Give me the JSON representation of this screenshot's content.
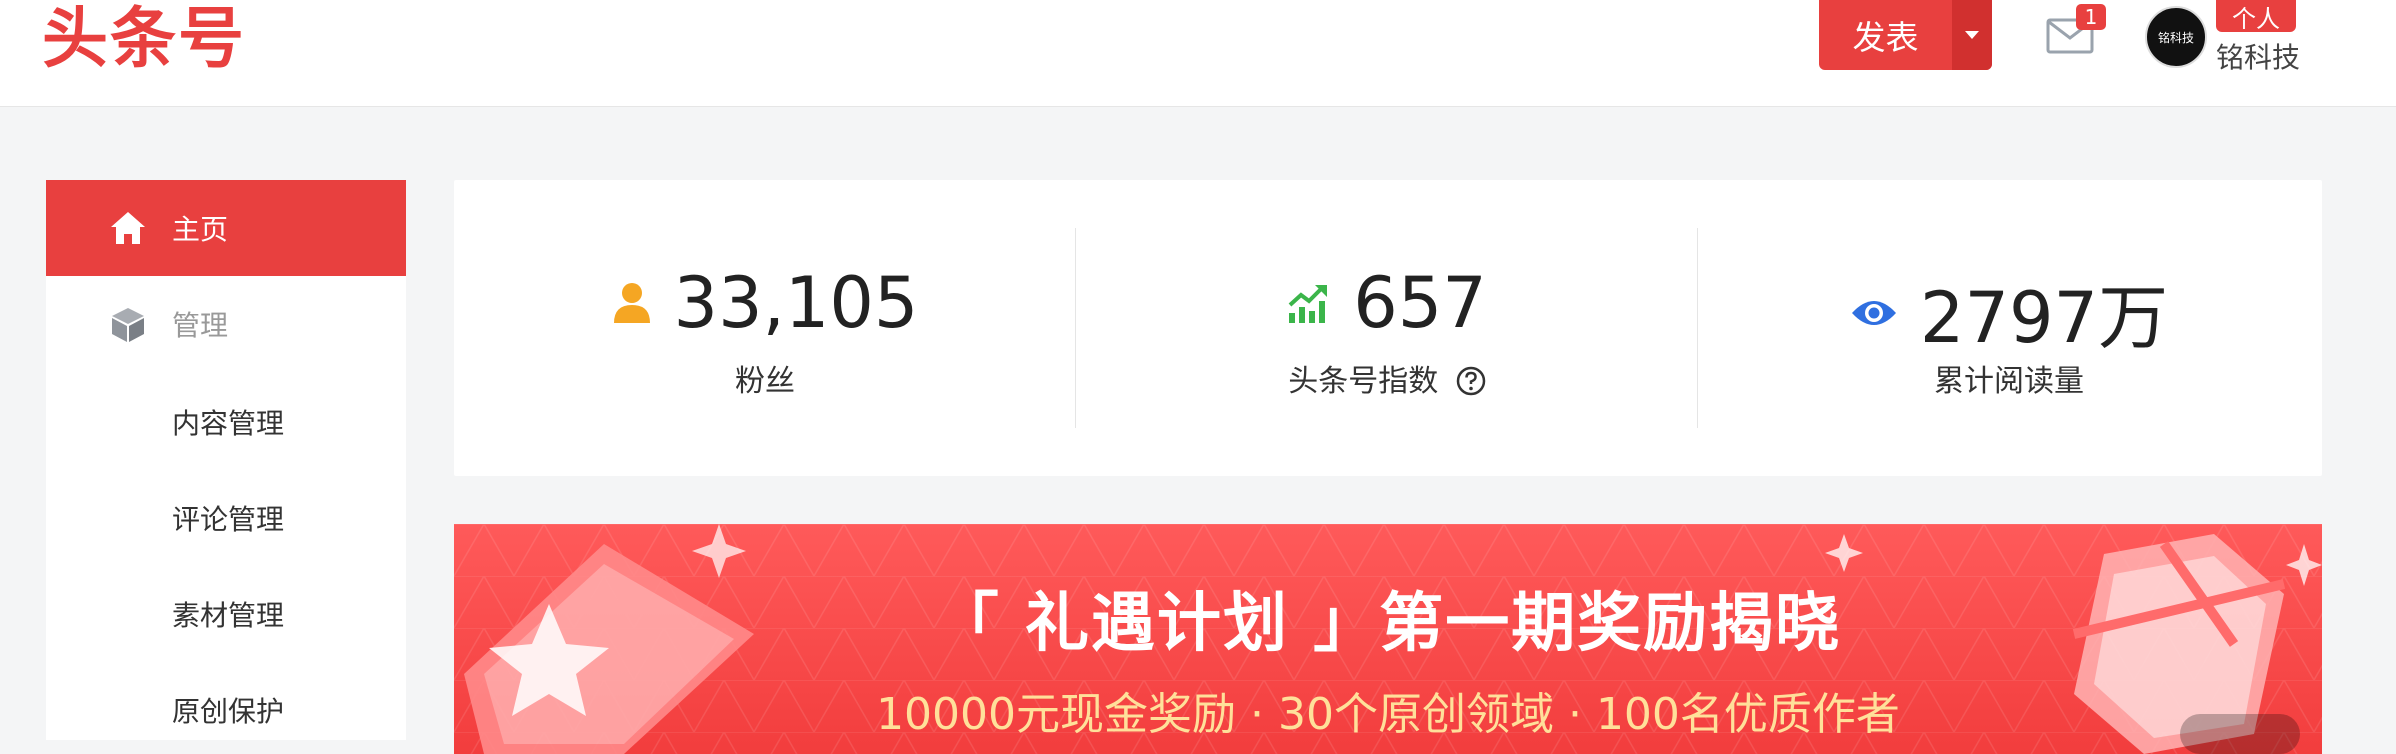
{
  "header": {
    "logo": "头条号",
    "publish_label": "发表",
    "mail_badge": "1",
    "avatar_text": "铭科技",
    "role_badge": "个人",
    "username": "铭科技"
  },
  "sidebar": {
    "home": "主页",
    "manage": "管理",
    "sub_items": [
      "内容管理",
      "评论管理",
      "素材管理",
      "原创保护"
    ]
  },
  "stats": [
    {
      "value": "33,105",
      "label": "粉丝",
      "icon": "user-icon",
      "color": "#f5a623"
    },
    {
      "value": "657",
      "label": "头条号指数",
      "icon": "trend-icon",
      "color": "#3bb54a"
    },
    {
      "value": "2797万",
      "label": "累计阅读量",
      "icon": "eye-icon",
      "color": "#2f6fe0"
    }
  ],
  "banner": {
    "title": "「 礼遇计划 」第一期奖励揭晓",
    "subtitle": "10000元现金奖励 · 30个原创领域 · 100名优质作者"
  },
  "colors": {
    "accent": "#e8403f"
  }
}
